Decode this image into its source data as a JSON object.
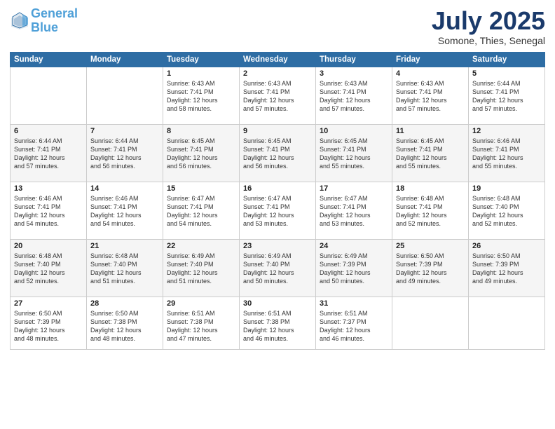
{
  "header": {
    "logo_line1": "General",
    "logo_line2": "Blue",
    "month": "July 2025",
    "location": "Somone, Thies, Senegal"
  },
  "weekdays": [
    "Sunday",
    "Monday",
    "Tuesday",
    "Wednesday",
    "Thursday",
    "Friday",
    "Saturday"
  ],
  "weeks": [
    [
      {
        "day": "",
        "info": ""
      },
      {
        "day": "",
        "info": ""
      },
      {
        "day": "1",
        "info": "Sunrise: 6:43 AM\nSunset: 7:41 PM\nDaylight: 12 hours\nand 58 minutes."
      },
      {
        "day": "2",
        "info": "Sunrise: 6:43 AM\nSunset: 7:41 PM\nDaylight: 12 hours\nand 57 minutes."
      },
      {
        "day": "3",
        "info": "Sunrise: 6:43 AM\nSunset: 7:41 PM\nDaylight: 12 hours\nand 57 minutes."
      },
      {
        "day": "4",
        "info": "Sunrise: 6:43 AM\nSunset: 7:41 PM\nDaylight: 12 hours\nand 57 minutes."
      },
      {
        "day": "5",
        "info": "Sunrise: 6:44 AM\nSunset: 7:41 PM\nDaylight: 12 hours\nand 57 minutes."
      }
    ],
    [
      {
        "day": "6",
        "info": "Sunrise: 6:44 AM\nSunset: 7:41 PM\nDaylight: 12 hours\nand 57 minutes."
      },
      {
        "day": "7",
        "info": "Sunrise: 6:44 AM\nSunset: 7:41 PM\nDaylight: 12 hours\nand 56 minutes."
      },
      {
        "day": "8",
        "info": "Sunrise: 6:45 AM\nSunset: 7:41 PM\nDaylight: 12 hours\nand 56 minutes."
      },
      {
        "day": "9",
        "info": "Sunrise: 6:45 AM\nSunset: 7:41 PM\nDaylight: 12 hours\nand 56 minutes."
      },
      {
        "day": "10",
        "info": "Sunrise: 6:45 AM\nSunset: 7:41 PM\nDaylight: 12 hours\nand 55 minutes."
      },
      {
        "day": "11",
        "info": "Sunrise: 6:45 AM\nSunset: 7:41 PM\nDaylight: 12 hours\nand 55 minutes."
      },
      {
        "day": "12",
        "info": "Sunrise: 6:46 AM\nSunset: 7:41 PM\nDaylight: 12 hours\nand 55 minutes."
      }
    ],
    [
      {
        "day": "13",
        "info": "Sunrise: 6:46 AM\nSunset: 7:41 PM\nDaylight: 12 hours\nand 54 minutes."
      },
      {
        "day": "14",
        "info": "Sunrise: 6:46 AM\nSunset: 7:41 PM\nDaylight: 12 hours\nand 54 minutes."
      },
      {
        "day": "15",
        "info": "Sunrise: 6:47 AM\nSunset: 7:41 PM\nDaylight: 12 hours\nand 54 minutes."
      },
      {
        "day": "16",
        "info": "Sunrise: 6:47 AM\nSunset: 7:41 PM\nDaylight: 12 hours\nand 53 minutes."
      },
      {
        "day": "17",
        "info": "Sunrise: 6:47 AM\nSunset: 7:41 PM\nDaylight: 12 hours\nand 53 minutes."
      },
      {
        "day": "18",
        "info": "Sunrise: 6:48 AM\nSunset: 7:41 PM\nDaylight: 12 hours\nand 52 minutes."
      },
      {
        "day": "19",
        "info": "Sunrise: 6:48 AM\nSunset: 7:40 PM\nDaylight: 12 hours\nand 52 minutes."
      }
    ],
    [
      {
        "day": "20",
        "info": "Sunrise: 6:48 AM\nSunset: 7:40 PM\nDaylight: 12 hours\nand 52 minutes."
      },
      {
        "day": "21",
        "info": "Sunrise: 6:48 AM\nSunset: 7:40 PM\nDaylight: 12 hours\nand 51 minutes."
      },
      {
        "day": "22",
        "info": "Sunrise: 6:49 AM\nSunset: 7:40 PM\nDaylight: 12 hours\nand 51 minutes."
      },
      {
        "day": "23",
        "info": "Sunrise: 6:49 AM\nSunset: 7:40 PM\nDaylight: 12 hours\nand 50 minutes."
      },
      {
        "day": "24",
        "info": "Sunrise: 6:49 AM\nSunset: 7:39 PM\nDaylight: 12 hours\nand 50 minutes."
      },
      {
        "day": "25",
        "info": "Sunrise: 6:50 AM\nSunset: 7:39 PM\nDaylight: 12 hours\nand 49 minutes."
      },
      {
        "day": "26",
        "info": "Sunrise: 6:50 AM\nSunset: 7:39 PM\nDaylight: 12 hours\nand 49 minutes."
      }
    ],
    [
      {
        "day": "27",
        "info": "Sunrise: 6:50 AM\nSunset: 7:39 PM\nDaylight: 12 hours\nand 48 minutes."
      },
      {
        "day": "28",
        "info": "Sunrise: 6:50 AM\nSunset: 7:38 PM\nDaylight: 12 hours\nand 48 minutes."
      },
      {
        "day": "29",
        "info": "Sunrise: 6:51 AM\nSunset: 7:38 PM\nDaylight: 12 hours\nand 47 minutes."
      },
      {
        "day": "30",
        "info": "Sunrise: 6:51 AM\nSunset: 7:38 PM\nDaylight: 12 hours\nand 46 minutes."
      },
      {
        "day": "31",
        "info": "Sunrise: 6:51 AM\nSunset: 7:37 PM\nDaylight: 12 hours\nand 46 minutes."
      },
      {
        "day": "",
        "info": ""
      },
      {
        "day": "",
        "info": ""
      }
    ]
  ]
}
